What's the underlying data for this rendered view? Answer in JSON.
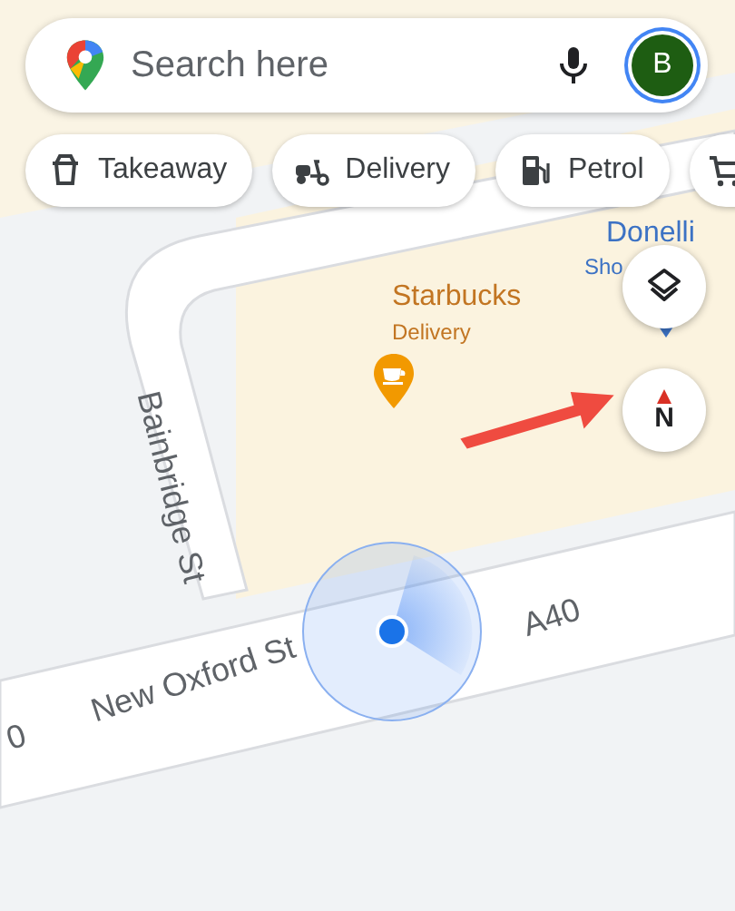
{
  "search": {
    "placeholder": "Search here",
    "avatar": "B"
  },
  "chips": [
    {
      "label": "Takeaway"
    },
    {
      "label": "Delivery"
    },
    {
      "label": "Petrol"
    }
  ],
  "places": [
    {
      "name": "Starbucks",
      "note": "Delivery"
    },
    {
      "name": "Donelli",
      "note": "Sho"
    }
  ],
  "streets": [
    {
      "kind": "side",
      "name": "Bainbridge St"
    },
    {
      "kind": "main",
      "name": "New Oxford St"
    },
    {
      "kind": "route",
      "name": "A40"
    },
    {
      "kind": "edge",
      "name": "0"
    }
  ],
  "compass": {
    "label": "N"
  }
}
